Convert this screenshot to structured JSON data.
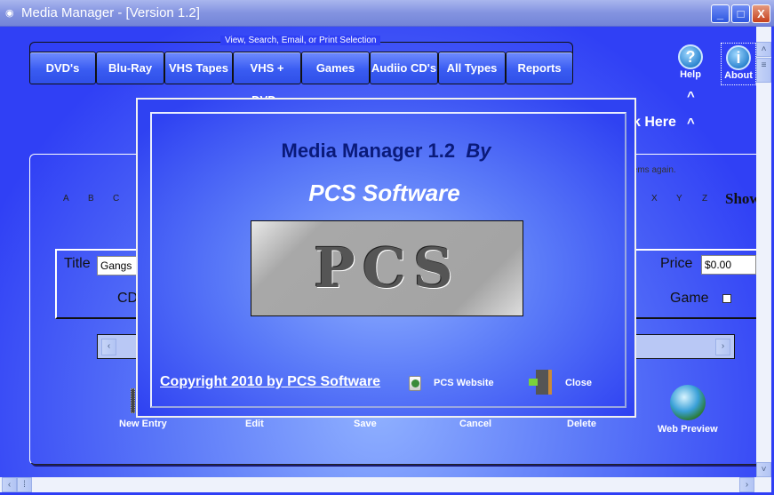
{
  "window": {
    "title": "Media Manager - [Version 1.2]",
    "minimize": "_",
    "maximize": "□",
    "close": "X"
  },
  "toolbar": {
    "group_label": "View, Search, Email, or Print Selection",
    "buttons": [
      "DVD's",
      "Blu-Ray",
      "VHS Tapes",
      "VHS + DVDs",
      "Games",
      "Audiio CD's",
      "All Types",
      "Reports"
    ]
  },
  "help": {
    "label": "Help",
    "icon": "?",
    "caret": "^"
  },
  "about": {
    "label": "About",
    "icon": "i"
  },
  "click_here": {
    "text": "k Here",
    "caret": "^"
  },
  "hint_text": "tems again.",
  "letters_left": [
    "A",
    "B",
    "C"
  ],
  "letters_right": [
    "X",
    "Y",
    "Z"
  ],
  "show_label": "Show",
  "form": {
    "title_label": "Title",
    "title_value": "Gangs",
    "cd_label": "CD",
    "price_label": "Price",
    "price_value": "$0.00",
    "game_label": "Game"
  },
  "actions": [
    "New Entry",
    "Edit",
    "Save",
    "Cancel",
    "Delete"
  ],
  "web_preview": "Web Preview",
  "dialog": {
    "heading": "Media Manager 1.2",
    "heading_by": "By",
    "company": "PCS Software",
    "logo_text": "PCS",
    "copyright": "Copyright 2010 by PCS Software",
    "website": "PCS Website",
    "close": "Close"
  },
  "colors": {
    "background": "#2f3ff5",
    "heading": "#0a1a7a"
  }
}
